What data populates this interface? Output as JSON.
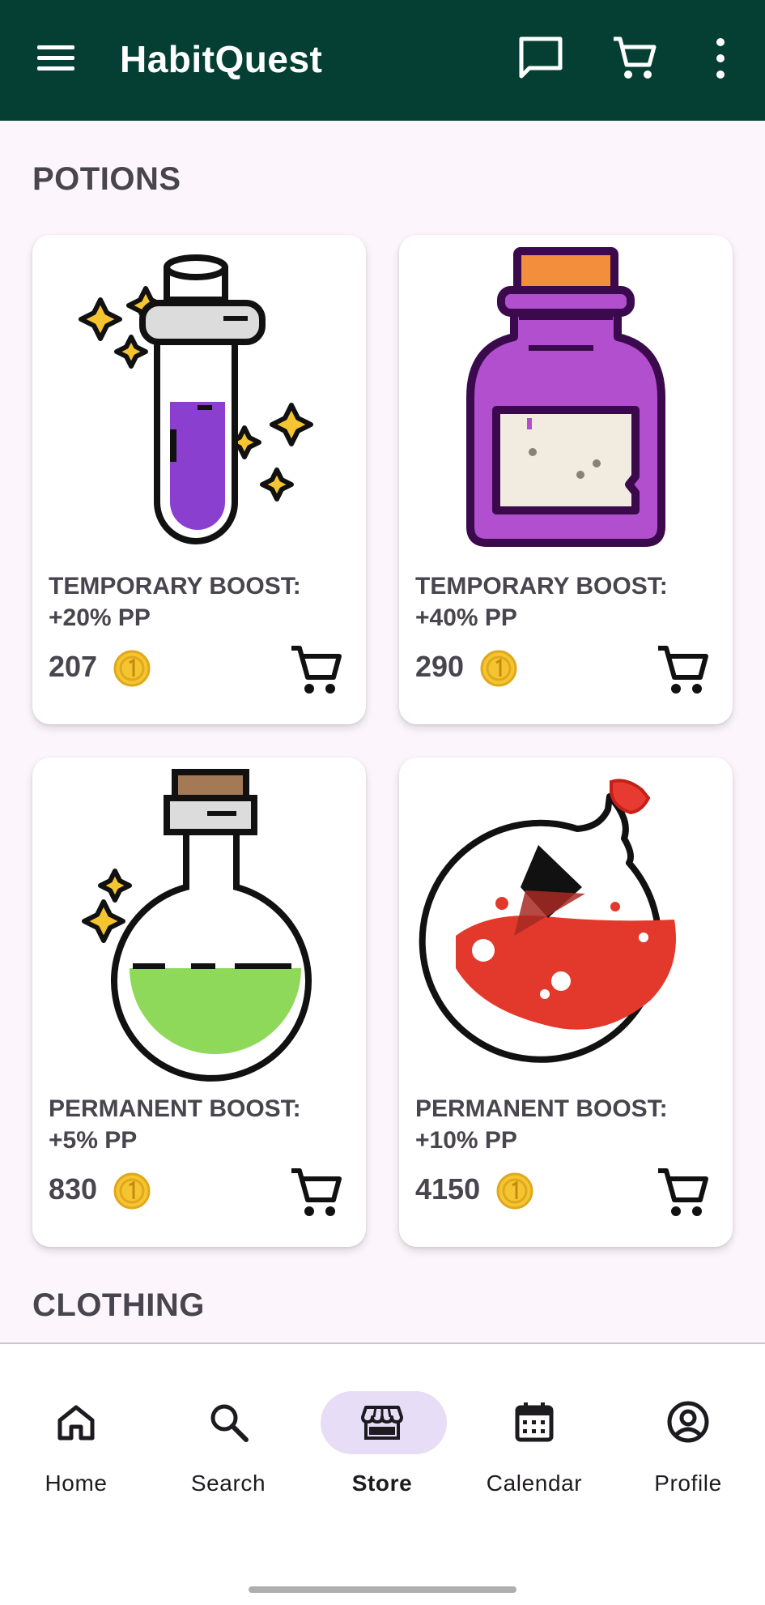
{
  "app": {
    "title": "HabitQuest"
  },
  "sections": {
    "potions": "POTIONS",
    "clothing": "CLOTHING"
  },
  "items": [
    {
      "name": "TEMPORARY BOOST: +20% PP",
      "price": "207"
    },
    {
      "name": "TEMPORARY BOOST: +40% PP",
      "price": "290"
    },
    {
      "name": "PERMANENT BOOST: +5% PP",
      "price": "830"
    },
    {
      "name": "PERMANENT BOOST: +10% PP",
      "price": "4150"
    }
  ],
  "nav": [
    {
      "label": "Home",
      "icon": "home-icon"
    },
    {
      "label": "Search",
      "icon": "search-icon"
    },
    {
      "label": "Store",
      "icon": "store-icon",
      "active": true
    },
    {
      "label": "Calendar",
      "icon": "calendar-icon"
    },
    {
      "label": "Profile",
      "icon": "profile-icon"
    }
  ],
  "colors": {
    "appbar": "#053f33",
    "background": "#fcf6fc",
    "nav_active_pill": "#e8ddf6",
    "coin": "#f5c531"
  }
}
